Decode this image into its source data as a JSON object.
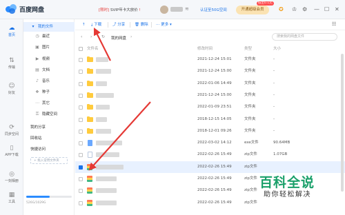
{
  "app": {
    "name": "百度网盘"
  },
  "header": {
    "promo_prefix": "[限时]",
    "promo_text": "SVIP年卡大放价",
    "promo_dot": "!",
    "cert_text": "认证至50G空间",
    "vip_button": "开通超级会员",
    "vip_badge": "低至0.1元",
    "icons": [
      "game-icon",
      "shirt-icon",
      "gear-icon",
      "minimize-icon",
      "maximize-icon",
      "close-icon"
    ]
  },
  "nav": {
    "home": "首页",
    "share": "传输",
    "friends": "好友",
    "sync": "同步空间",
    "app_download": "APP下载",
    "one_click": "一刻相册",
    "tools": "工具"
  },
  "sidebar": {
    "my_files": "我的文件",
    "items": [
      {
        "label": "最近",
        "icon": "clock-icon"
      },
      {
        "label": "图片",
        "icon": "image-icon"
      },
      {
        "label": "视频",
        "icon": "video-icon"
      },
      {
        "label": "文档",
        "icon": "document-icon"
      },
      {
        "label": "音乐",
        "icon": "music-icon"
      },
      {
        "label": "种子",
        "icon": "seed-icon"
      },
      {
        "label": "其它",
        "icon": "more-icon"
      },
      {
        "label": "隐藏空间",
        "icon": "lock-icon"
      }
    ],
    "my_share": "我的分享",
    "recycle": "回收站",
    "quick_access": "快捷访问",
    "add_quick": "+ 拖入常用文件夹",
    "storage_text": "526G/1029G",
    "storage_used_fraction": 0.51
  },
  "toolbar": {
    "upload": "↑",
    "download": "下载",
    "share": "分享",
    "delete": "删除",
    "more": "更多 ▾"
  },
  "pathbar": {
    "path": "我的网盘",
    "search_placeholder": "搜索我的网盘文件"
  },
  "table": {
    "headers": {
      "name": "文件名",
      "date": "修改时间",
      "type": "类型",
      "size": "大小"
    },
    "rows": [
      {
        "kind": "folder",
        "date": "2021-12-24 15:01",
        "type": "文件夹",
        "size": "-",
        "checked": false
      },
      {
        "kind": "folder",
        "date": "2021-12-24 15:00",
        "type": "文件夹",
        "size": "-",
        "checked": false
      },
      {
        "kind": "folder",
        "date": "2022-01-06 14:49",
        "type": "文件夹",
        "size": "-",
        "checked": false
      },
      {
        "kind": "folder",
        "date": "2021-12-24 15:00",
        "type": "文件夹",
        "size": "-",
        "checked": false
      },
      {
        "kind": "folder",
        "date": "2022-01-09 23:51",
        "type": "文件夹",
        "size": "-",
        "checked": false
      },
      {
        "kind": "folder",
        "date": "2018-12-15 14:05",
        "type": "文件夹",
        "size": "-",
        "checked": false
      },
      {
        "kind": "folder",
        "date": "2018-12-01 09:26",
        "type": "文件夹",
        "size": "-",
        "checked": false
      },
      {
        "kind": "exe",
        "date": "2022-03-02 14:12",
        "type": "exe文件",
        "size": "90.64MB",
        "checked": false
      },
      {
        "kind": "doc",
        "date": "2022-02-26 15:49",
        "type": "zip文件",
        "size": "1.07GB",
        "checked": false
      },
      {
        "kind": "zip",
        "date": "2022-02-26 15:49",
        "type": "zip文件",
        "size": "",
        "checked": true
      },
      {
        "kind": "zip",
        "date": "2022-02-26 15:49",
        "type": "zip文件",
        "size": "",
        "checked": false
      },
      {
        "kind": "zip",
        "date": "2022-02-26 15:49",
        "type": "zip文件",
        "size": "",
        "checked": false
      },
      {
        "kind": "zip",
        "date": "2022-02-26 15:49",
        "type": "zip文件",
        "size": "",
        "checked": false
      }
    ]
  },
  "watermark": {
    "big": "百科全说",
    "small": "助你轻松解决"
  },
  "colors": {
    "accent": "#1a73e8",
    "selected_row": "#e8f1ff",
    "arrow": "#e53935",
    "watermark": "#1aa06a"
  }
}
